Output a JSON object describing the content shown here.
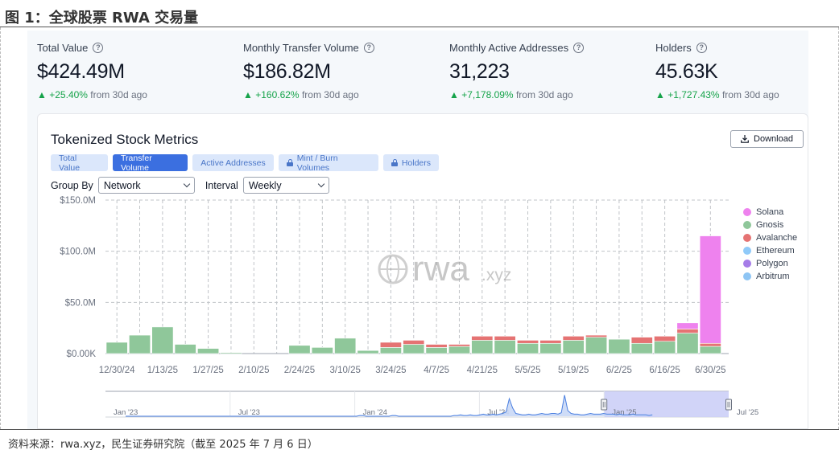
{
  "figure": {
    "title": "图 1：全球股票 RWA 交易量",
    "source": "资料来源：rwa.xyz，民生证券研究院（截至 2025 年 7 月 6 日）"
  },
  "metrics": [
    {
      "label": "Total Value",
      "value": "$424.49M",
      "change": "▲ +25.40%",
      "suffix": "from 30d ago"
    },
    {
      "label": "Monthly Transfer Volume",
      "value": "$186.82M",
      "change": "▲ +160.62%",
      "suffix": "from 30d ago"
    },
    {
      "label": "Monthly Active Addresses",
      "value": "31,223",
      "change": "▲ +7,178.09%",
      "suffix": "from 30d ago"
    },
    {
      "label": "Holders",
      "value": "45.63K",
      "change": "▲ +1,727.43%",
      "suffix": "from 30d ago"
    }
  ],
  "card": {
    "title": "Tokenized Stock Metrics",
    "download_label": "Download",
    "tabs": [
      {
        "label": "Total Value",
        "locked": false,
        "active": false
      },
      {
        "label": "Transfer Volume",
        "locked": false,
        "active": true
      },
      {
        "label": "Active Addresses",
        "locked": false,
        "active": false
      },
      {
        "label": "Mint / Burn Volumes",
        "locked": true,
        "active": false
      },
      {
        "label": "Holders",
        "locked": true,
        "active": false
      }
    ],
    "group_by_label": "Group By",
    "group_by_value": "Network",
    "interval_label": "Interval",
    "interval_value": "Weekly"
  },
  "watermark": {
    "main": "rwa",
    "suffix": ".xyz"
  },
  "colors": {
    "Solana": "#ee82ee",
    "Gnosis": "#8fc79a",
    "Avalanche": "#e57373",
    "Ethereum": "#90caf9",
    "Polygon": "#a67de8",
    "Arbitrum": "#8ec5f4",
    "grid": "#c0c4c8",
    "navigator_line": "#4a7fe0",
    "navigator_fill": "#c9d8f6",
    "navigator_window": "#c9ccf7"
  },
  "chart_data": {
    "type": "bar",
    "stacked": true,
    "interval": "weekly",
    "ylim": [
      0,
      150
    ],
    "y_unit": "M USD",
    "yticks": [
      "$0.00K",
      "$50.0M",
      "$100.0M",
      "$150.0M"
    ],
    "xticks": [
      "12/30/24",
      "1/13/25",
      "1/27/25",
      "2/10/25",
      "2/24/25",
      "3/10/25",
      "3/24/25",
      "4/7/25",
      "4/21/25",
      "5/5/25",
      "5/19/25",
      "6/2/25",
      "6/16/25",
      "6/30/25"
    ],
    "legend": [
      "Solana",
      "Gnosis",
      "Avalanche",
      "Ethereum",
      "Polygon",
      "Arbitrum"
    ],
    "legend_position": "right",
    "grid": true,
    "categories": [
      "12/30/24",
      "1/6/25",
      "1/13/25",
      "1/20/25",
      "1/27/25",
      "2/3/25",
      "2/10/25",
      "2/17/25",
      "2/24/25",
      "3/3/25",
      "3/10/25",
      "3/17/25",
      "3/24/25",
      "3/31/25",
      "4/7/25",
      "4/14/25",
      "4/21/25",
      "4/28/25",
      "5/5/25",
      "5/12/25",
      "5/19/25",
      "5/26/25",
      "6/2/25",
      "6/9/25",
      "6/16/25",
      "6/23/25",
      "6/30/25"
    ],
    "series": [
      {
        "name": "Gnosis",
        "values": [
          11,
          18,
          26,
          9,
          5,
          1,
          0,
          0,
          8,
          6,
          15,
          3,
          6,
          9,
          6,
          7,
          13,
          13,
          10,
          10,
          13,
          16,
          14,
          10,
          12,
          20,
          7
        ]
      },
      {
        "name": "Avalanche",
        "values": [
          0,
          0,
          0,
          0,
          0,
          0,
          0,
          0,
          0,
          0,
          0,
          0,
          5,
          4,
          3,
          2,
          4,
          4,
          3,
          3,
          4,
          2,
          0,
          6,
          5,
          4,
          3
        ]
      },
      {
        "name": "Solana",
        "values": [
          0,
          0,
          0,
          0,
          0,
          0,
          0,
          0,
          0,
          0,
          0,
          0,
          0,
          0,
          0,
          0,
          0,
          0,
          0,
          0,
          0,
          0,
          0,
          0,
          0,
          6,
          105
        ]
      },
      {
        "name": "Ethereum",
        "values": [
          0,
          0,
          0,
          0,
          0,
          0,
          0,
          0,
          0,
          0,
          0,
          0,
          0,
          0,
          0,
          0,
          0,
          0,
          0,
          0,
          0,
          0,
          0,
          0,
          0,
          0,
          0
        ]
      },
      {
        "name": "Polygon",
        "values": [
          0,
          0,
          0,
          0,
          0,
          0,
          0,
          0,
          0,
          0,
          0,
          0,
          0,
          0,
          0,
          0,
          0,
          0,
          0,
          0,
          0,
          0,
          0,
          0,
          0,
          0,
          0
        ]
      },
      {
        "name": "Arbitrum",
        "values": [
          0,
          0,
          0,
          0,
          0,
          0,
          0,
          0,
          0,
          0,
          0,
          0,
          0,
          0,
          0,
          0,
          0,
          0,
          0,
          0,
          0,
          0,
          0,
          0,
          0,
          0,
          0
        ]
      }
    ],
    "navigator": {
      "labels": [
        "Jan '23",
        "Jul '23",
        "Jan '24",
        "Jul '24",
        "Jan '25",
        "Jul '25"
      ],
      "selected_range": [
        "Jan '25",
        "Jul '25"
      ],
      "values": [
        0,
        0,
        0,
        0,
        0,
        0,
        0,
        0,
        0,
        0,
        0,
        0,
        0,
        0,
        0,
        0,
        0,
        0,
        0,
        0,
        0,
        0,
        0,
        0,
        0,
        0,
        0,
        0,
        0,
        0,
        0,
        0,
        0,
        0,
        0,
        0,
        0,
        0,
        0,
        0,
        0,
        0,
        0,
        0,
        0,
        0,
        0,
        0,
        0,
        0,
        0,
        0,
        0,
        0,
        0,
        0,
        0,
        0,
        0,
        0,
        0,
        0,
        0,
        0,
        0,
        0,
        0,
        0,
        0,
        0,
        0,
        0,
        1,
        1,
        0,
        0,
        0,
        0,
        0,
        0,
        0,
        0,
        1,
        1,
        0,
        0,
        0,
        0,
        0,
        0,
        0,
        0,
        0,
        0,
        0,
        0,
        0,
        0,
        0,
        0,
        0,
        1,
        1,
        2,
        1,
        1,
        2,
        1,
        1,
        2,
        3,
        2,
        2,
        3,
        2,
        3,
        4,
        6,
        25,
        12,
        4,
        3,
        2,
        2,
        3,
        2,
        2,
        3,
        4,
        3,
        3,
        4,
        4,
        3,
        5,
        30,
        8,
        4,
        3,
        3,
        2,
        2,
        3,
        4,
        3,
        3,
        3,
        4,
        3,
        3,
        3,
        2,
        3,
        2,
        2,
        2,
        3,
        2,
        2,
        2,
        2,
        1,
        2
      ]
    }
  }
}
